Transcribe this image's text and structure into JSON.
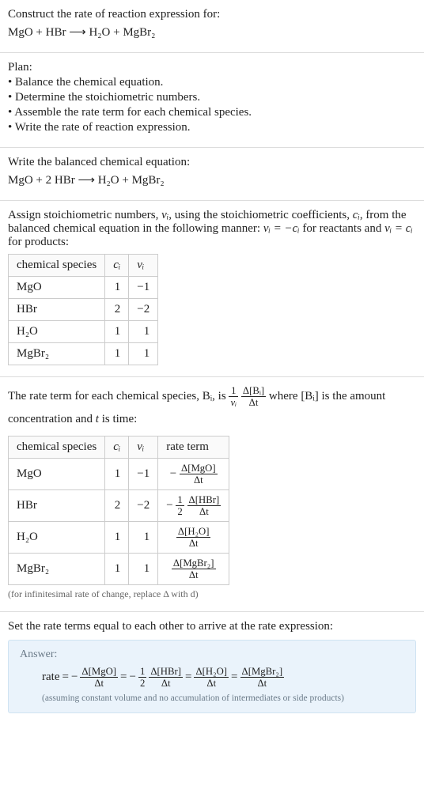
{
  "intro": {
    "construct_line": "Construct the rate of reaction expression for:",
    "equation_plain": "MgO + HBr ⟶ H₂O + MgBr₂"
  },
  "plan": {
    "heading": "Plan:",
    "items": [
      "Balance the chemical equation.",
      "Determine the stoichiometric numbers.",
      "Assemble the rate term for each chemical species.",
      "Write the rate of reaction expression."
    ]
  },
  "balanced": {
    "lead": "Write the balanced chemical equation:",
    "equation": "MgO + 2 HBr ⟶ H₂O + MgBr₂"
  },
  "stoich": {
    "lead_a": "Assign stoichiometric numbers, ",
    "nu_i": "νᵢ",
    "lead_b": ", using the stoichiometric coefficients, ",
    "c_i": "cᵢ",
    "lead_c": ", from the balanced chemical equation in the following manner: ",
    "rel_react": "νᵢ = −cᵢ",
    "lead_d": " for reactants and ",
    "rel_prod": "νᵢ = cᵢ",
    "lead_e": " for products:",
    "headers": {
      "species": "chemical species",
      "c": "cᵢ",
      "nu": "νᵢ"
    },
    "rows": [
      {
        "species": "MgO",
        "c": "1",
        "nu": "−1"
      },
      {
        "species": "HBr",
        "c": "2",
        "nu": "−2"
      },
      {
        "species": "H₂O",
        "c": "1",
        "nu": "1"
      },
      {
        "species": "MgBr₂",
        "c": "1",
        "nu": "1"
      }
    ]
  },
  "rate_term": {
    "lead_a": "The rate term for each chemical species, ",
    "B_i": "Bᵢ",
    "lead_b": ", is ",
    "frac1_num": "1",
    "frac1_den": "νᵢ",
    "frac2_num": "Δ[Bᵢ]",
    "frac2_den": "Δt",
    "lead_c": " where ",
    "conc": "[Bᵢ]",
    "lead_d": " is the amount concentration and ",
    "t": "t",
    "lead_e": " is time:",
    "headers": {
      "species": "chemical species",
      "c": "cᵢ",
      "nu": "νᵢ",
      "rate": "rate term"
    },
    "rows": [
      {
        "species": "MgO",
        "c": "1",
        "nu": "−1",
        "sign": "−",
        "coef_num": "",
        "coef_den": "",
        "d_num": "Δ[MgO]",
        "d_den": "Δt"
      },
      {
        "species": "HBr",
        "c": "2",
        "nu": "−2",
        "sign": "−",
        "coef_num": "1",
        "coef_den": "2",
        "d_num": "Δ[HBr]",
        "d_den": "Δt"
      },
      {
        "species": "H₂O",
        "c": "1",
        "nu": "1",
        "sign": "",
        "coef_num": "",
        "coef_den": "",
        "d_num": "Δ[H₂O]",
        "d_den": "Δt"
      },
      {
        "species": "MgBr₂",
        "c": "1",
        "nu": "1",
        "sign": "",
        "coef_num": "",
        "coef_den": "",
        "d_num": "Δ[MgBr₂]",
        "d_den": "Δt"
      }
    ],
    "note": "(for infinitesimal rate of change, replace Δ with d)"
  },
  "final": {
    "lead": "Set the rate terms equal to each other to arrive at the rate expression:",
    "answer_label": "Answer:",
    "rate_word": "rate",
    "eq": "=",
    "terms": [
      {
        "sign": "−",
        "coef_num": "",
        "coef_den": "",
        "d_num": "Δ[MgO]",
        "d_den": "Δt"
      },
      {
        "sign": "−",
        "coef_num": "1",
        "coef_den": "2",
        "d_num": "Δ[HBr]",
        "d_den": "Δt"
      },
      {
        "sign": "",
        "coef_num": "",
        "coef_den": "",
        "d_num": "Δ[H₂O]",
        "d_den": "Δt"
      },
      {
        "sign": "",
        "coef_num": "",
        "coef_den": "",
        "d_num": "Δ[MgBr₂]",
        "d_den": "Δt"
      }
    ],
    "assumption": "(assuming constant volume and no accumulation of intermediates or side products)"
  },
  "chart_data": {
    "type": "table",
    "tables": [
      {
        "title": "Stoichiometric numbers",
        "columns": [
          "chemical species",
          "cᵢ",
          "νᵢ"
        ],
        "rows": [
          [
            "MgO",
            1,
            -1
          ],
          [
            "HBr",
            2,
            -2
          ],
          [
            "H₂O",
            1,
            1
          ],
          [
            "MgBr₂",
            1,
            1
          ]
        ]
      },
      {
        "title": "Rate terms",
        "columns": [
          "chemical species",
          "cᵢ",
          "νᵢ",
          "rate term"
        ],
        "rows": [
          [
            "MgO",
            1,
            -1,
            "−Δ[MgO]/Δt"
          ],
          [
            "HBr",
            2,
            -2,
            "−(1/2) Δ[HBr]/Δt"
          ],
          [
            "H₂O",
            1,
            1,
            "Δ[H₂O]/Δt"
          ],
          [
            "MgBr₂",
            1,
            1,
            "Δ[MgBr₂]/Δt"
          ]
        ]
      }
    ]
  }
}
